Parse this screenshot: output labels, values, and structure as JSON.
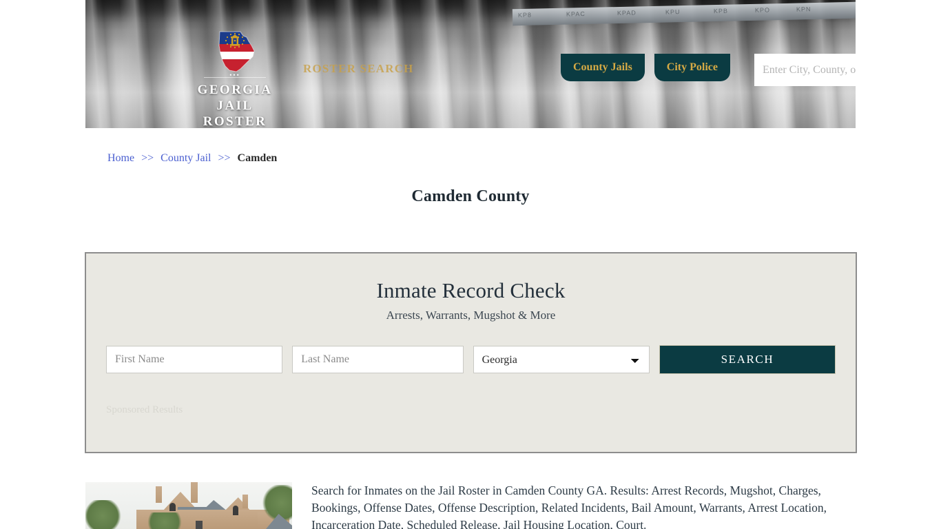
{
  "header": {
    "logo": {
      "line1": "GEORGIA",
      "line2": "JAIL ROSTER",
      "mark_icon": "georgia-state-flag-icon"
    },
    "tagline": "ROSTER SEARCH",
    "nav": [
      {
        "label": "County Jails",
        "name": "nav-county-jails"
      },
      {
        "label": "City Police",
        "name": "nav-city-police"
      }
    ],
    "search": {
      "placeholder": "Enter City, County, or Facil",
      "value": "",
      "button_icon": "search-icon"
    },
    "colors": {
      "nav_background": "#0b3b42",
      "nav_text": "#d6aa45",
      "tagline": "#c8a14a"
    }
  },
  "breadcrumb": {
    "items": [
      {
        "label": "Home",
        "link": true
      },
      {
        "label": "County Jail",
        "link": true
      },
      {
        "label": "Camden",
        "link": false
      }
    ],
    "separator": ">>"
  },
  "page_title": "Camden County",
  "panel": {
    "title": "Inmate Record Check",
    "subtitle": "Arrests, Warrants, Mugshot & More",
    "form": {
      "first_name": {
        "placeholder": "First Name",
        "value": ""
      },
      "last_name": {
        "placeholder": "Last Name",
        "value": ""
      },
      "state": {
        "selected": "Georgia",
        "options": [
          "Georgia"
        ]
      },
      "submit_label": "SEARCH"
    },
    "sponsored_label": "Sponsored Results",
    "colors": {
      "panel_background": "#e9e8e2",
      "panel_border": "#8d8d8d",
      "submit_background": "#0b3b42"
    }
  },
  "content": {
    "thumbnail_alt": "camden-county-jail-building-photo",
    "paragraph": "Search for Inmates on the Jail Roster in Camden County GA. Results: Arrest Records, Mugshot, Charges, Bookings, Offense Dates, Offense Description, Related Incidents, Bail Amount, Warrants, Arrest Location, Incarceration Date, Scheduled Release, Jail Housing Location, Court."
  }
}
